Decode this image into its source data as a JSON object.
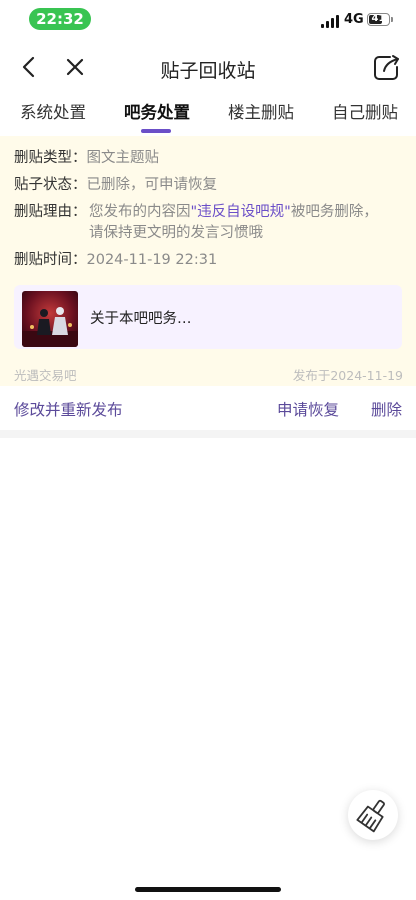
{
  "status": {
    "time": "22:32",
    "network": "4G",
    "battery": "41"
  },
  "nav": {
    "title": "贴子回收站"
  },
  "tabs": [
    {
      "label": "系统处置"
    },
    {
      "label": "吧务处置"
    },
    {
      "label": "楼主删贴"
    },
    {
      "label": "自己删贴"
    }
  ],
  "details": {
    "type_label": "删贴类型：",
    "type_value": "图文主题贴",
    "status_label": "贴子状态：",
    "status_value": "已删除，可申请恢复",
    "reason_label": "删贴理由：",
    "reason_prefix": "您发布的内容因",
    "reason_highlight": "\"违反自设吧规\"",
    "reason_suffix": "被吧务删除，请保持更文明的发言习惯哦",
    "time_label": "删贴时间：",
    "time_value": "2024-11-19 22:31"
  },
  "post": {
    "title": "关于本吧吧务…"
  },
  "meta": {
    "forum": "光遇交易吧",
    "published": "发布于2024-11-19"
  },
  "actions": {
    "edit_repost": "修改并重新发布",
    "appeal": "申请恢复",
    "delete": "删除"
  },
  "colors": {
    "accent": "#6b4fc8",
    "status_pill": "#39c452",
    "card_bg": "#fffbea"
  }
}
